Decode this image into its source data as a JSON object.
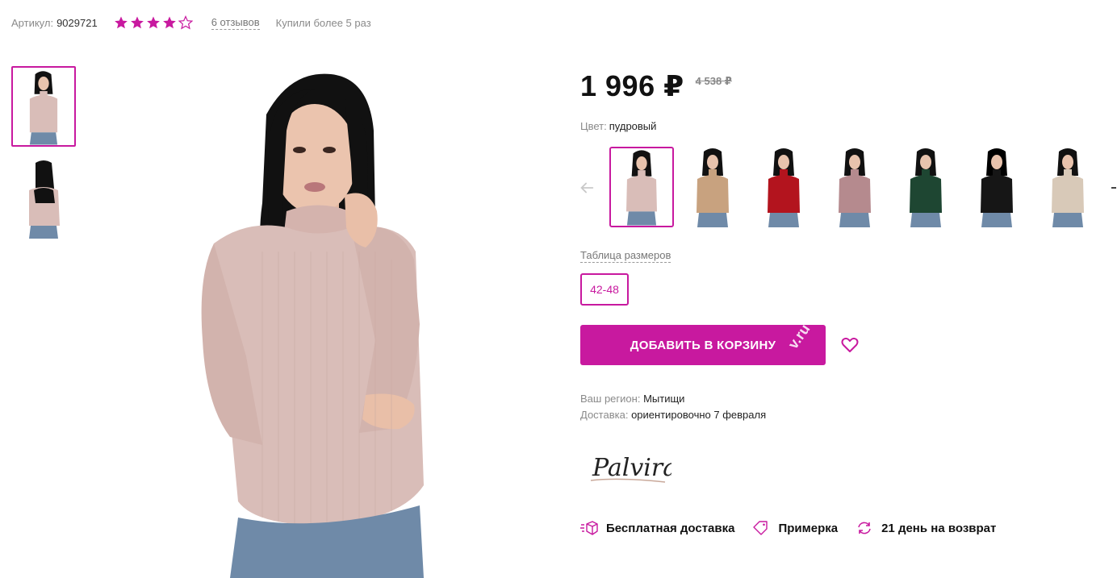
{
  "meta": {
    "sku_label": "Артикул:",
    "sku_value": "9029721",
    "rating": 4,
    "rating_max": 5,
    "reviews": "6 отзывов",
    "bought": "Купили более 5 раз"
  },
  "product": {
    "price": "1 996 ₽",
    "old_price": "4 538 ₽",
    "color_label": "Цвет:",
    "color_value": "пудровый",
    "size_table_link": "Таблица размеров",
    "size_option": "42-48",
    "add_to_cart": "ДОБАВИТЬ В КОРЗИНУ",
    "cart_watermark": "v.ru"
  },
  "swatches": [
    {
      "color": "#d9bdb8"
    },
    {
      "color": "#c8a27f"
    },
    {
      "color": "#b3141e"
    },
    {
      "color": "#b58a8e"
    },
    {
      "color": "#1e4632"
    },
    {
      "color": "#161616"
    },
    {
      "color": "#d8c9b8"
    }
  ],
  "delivery": {
    "region_label": "Ваш регион:",
    "region_value": "Мытищи",
    "delivery_label": "Доставка:",
    "delivery_value": "ориентировочно 7 февраля"
  },
  "brand": {
    "logo_text": "Palvira"
  },
  "features": [
    {
      "icon": "box-icon",
      "label": "Бесплатная доставка"
    },
    {
      "icon": "tag-icon",
      "label": "Примерка"
    },
    {
      "icon": "refresh-icon",
      "label": "21 день на возврат"
    }
  ],
  "colors": {
    "accent": "#c8199f",
    "sweater": "#d9bdb8",
    "hair": "#111111",
    "jeans": "#6f8aa8"
  }
}
